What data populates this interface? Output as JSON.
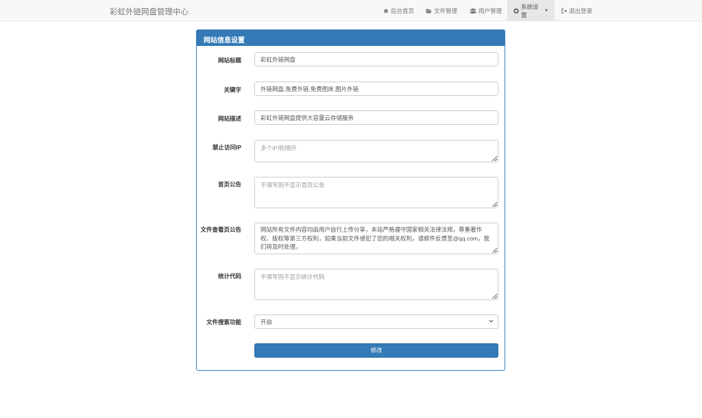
{
  "navbar": {
    "brand": "彩虹外链网盘管理中心",
    "items": [
      {
        "label": "后台首页",
        "icon": "home-icon"
      },
      {
        "label": "文件管理",
        "icon": "folder-open-icon"
      },
      {
        "label": "用户管理",
        "icon": "users-icon"
      },
      {
        "label": "系统设置",
        "icon": "gear-icon",
        "active": true
      },
      {
        "label": "退出登录",
        "icon": "logout-icon"
      }
    ]
  },
  "panel": {
    "title": "网站信息设置"
  },
  "form": {
    "site_title": {
      "label": "网站标题",
      "value": "彩虹外链网盘"
    },
    "keywords": {
      "label": "关键字",
      "value": "外链网盘,免费外链,免费图床,图片外链"
    },
    "description": {
      "label": "网站描述",
      "value": "彩虹外链网盘提供大容量云存储服务"
    },
    "blocked_ip": {
      "label": "禁止访问IP",
      "value": "",
      "placeholder": "多个IP用|隔开"
    },
    "home_notice": {
      "label": "首页公告",
      "value": "",
      "placeholder": "不填写则不显示首页公告"
    },
    "file_notice": {
      "label": "文件查看页公告",
      "value": "网站所有文件内容均由用户自行上传分享，本站严格遵守国家相关法律法规，尊重著作权、版权等第三方权利，如果当前文件侵犯了您的相关权利，请邮件反馈至@qq.com，我们将及时处理。"
    },
    "stats_code": {
      "label": "统计代码",
      "value": "",
      "placeholder": "不填写则不显示统计代码"
    },
    "file_search": {
      "label": "文件搜索功能",
      "value": "开启"
    },
    "submit_label": "修改"
  },
  "colors": {
    "primary": "#337ab7",
    "navbar_bg": "#f8f8f8",
    "active_nav_bg": "#e7e7e7"
  }
}
